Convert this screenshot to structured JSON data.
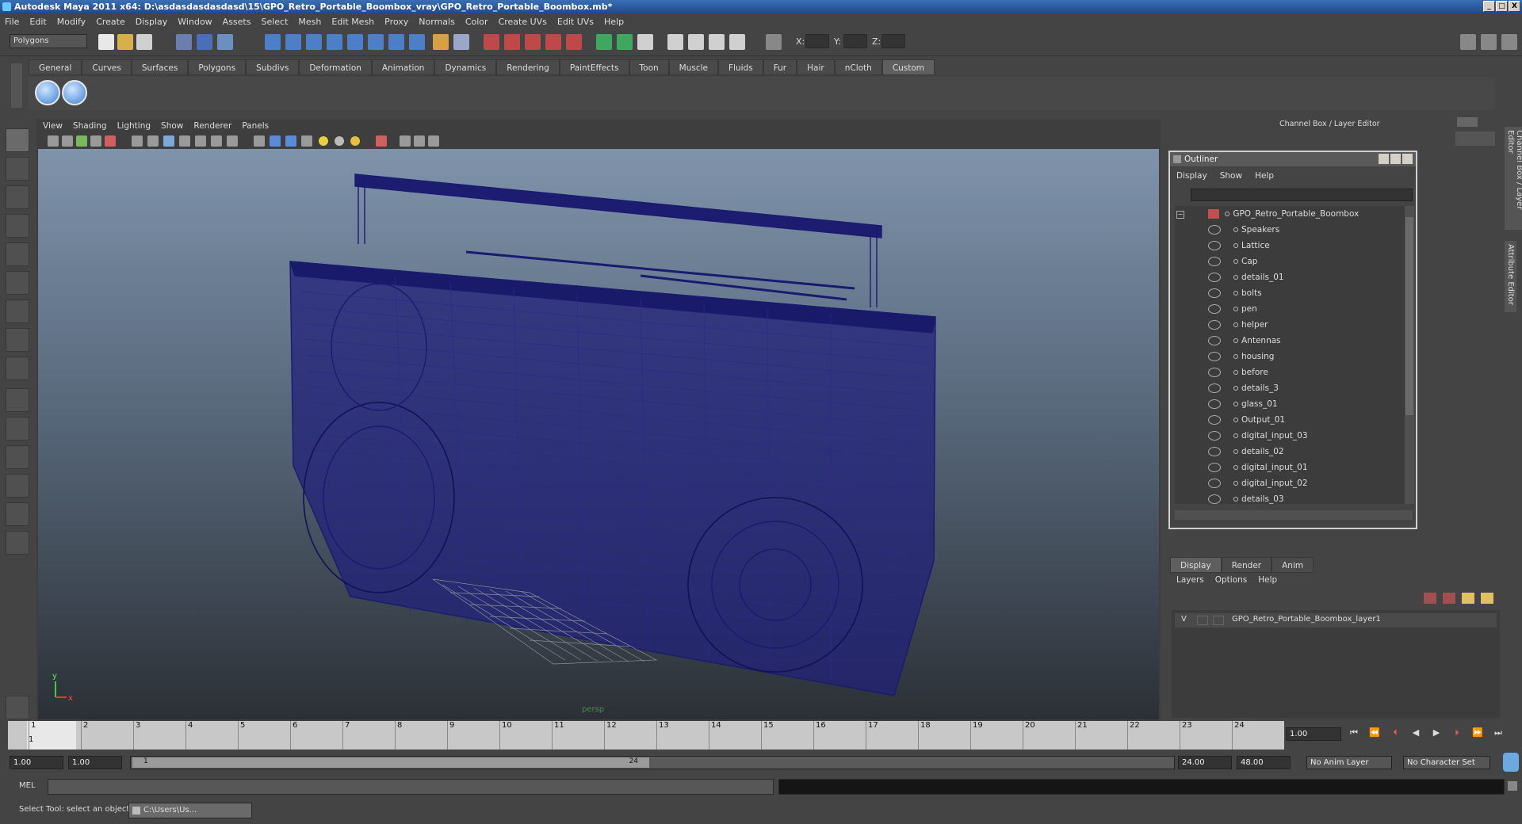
{
  "window": {
    "title": "Autodesk Maya 2011 x64: D:\\asdasdasdasdasd\\15\\GPO_Retro_Portable_Boombox_vray\\GPO_Retro_Portable_Boombox.mb*",
    "min": "_",
    "max": "□",
    "close": "X"
  },
  "menu": [
    "File",
    "Edit",
    "Modify",
    "Create",
    "Display",
    "Window",
    "Assets",
    "Select",
    "Mesh",
    "Edit Mesh",
    "Proxy",
    "Normals",
    "Color",
    "Create UVs",
    "Edit UVs",
    "Help"
  ],
  "status": {
    "mode": "Polygons",
    "x_label": "X:",
    "y_label": "Y:",
    "z_label": "Z:"
  },
  "shelf_tabs": [
    "General",
    "Curves",
    "Surfaces",
    "Polygons",
    "Subdivs",
    "Deformation",
    "Animation",
    "Dynamics",
    "Rendering",
    "PaintEffects",
    "Toon",
    "Muscle",
    "Fluids",
    "Fur",
    "Hair",
    "nCloth",
    "Custom"
  ],
  "viewport": {
    "menu": [
      "View",
      "Shading",
      "Lighting",
      "Show",
      "Renderer",
      "Panels"
    ],
    "camera": "persp",
    "axis_x": "x",
    "axis_y": "y"
  },
  "channel_box_title": "Channel Box / Layer Editor",
  "side_tabs": {
    "channel": "Channel Box / Layer Editor",
    "attr": "Attribute Editor"
  },
  "outliner": {
    "title": "Outliner",
    "menu": [
      "Display",
      "Show",
      "Help"
    ],
    "root": "GPO_Retro_Portable_Boombox",
    "items": [
      "Speakers",
      "Lattice",
      "Cap",
      "details_01",
      "bolts",
      "pen",
      "helper",
      "Antennas",
      "housing",
      "before",
      "details_3",
      "glass_01",
      "Output_01",
      "digital_input_03",
      "details_02",
      "digital_input_01",
      "digital_input_02",
      "details_03"
    ]
  },
  "layer_editor": {
    "tabs": [
      "Display",
      "Render",
      "Anim"
    ],
    "menu": [
      "Layers",
      "Options",
      "Help"
    ],
    "layer_visibility": "V",
    "layer_name": "GPO_Retro_Portable_Boombox_layer1"
  },
  "timeline": {
    "ticks": [
      "1",
      "2",
      "3",
      "4",
      "5",
      "6",
      "7",
      "8",
      "9",
      "10",
      "11",
      "12",
      "13",
      "14",
      "15",
      "16",
      "17",
      "18",
      "19",
      "20",
      "21",
      "22",
      "23",
      "24"
    ],
    "current_frame": "1.00",
    "playhead": "1"
  },
  "range": {
    "start": "1.00",
    "inner_start": "1.00",
    "slider_start": "1",
    "slider_end": "24",
    "end": "24.00",
    "outer_end": "48.00",
    "anim_layer": "No Anim Layer",
    "char_set": "No Character Set"
  },
  "mel": {
    "label": "MEL"
  },
  "help_line": "Select Tool: select an object",
  "taskbar_item": "C:\\Users\\Us..."
}
